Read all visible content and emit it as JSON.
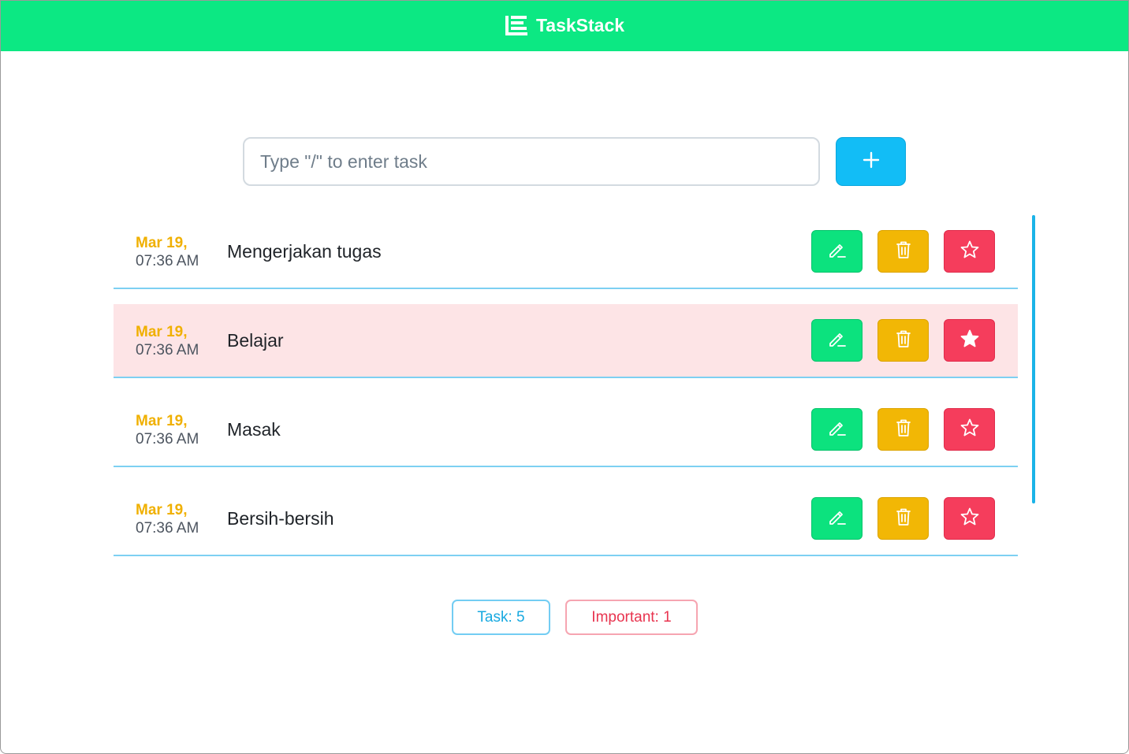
{
  "header": {
    "title": "TaskStack",
    "background_color": "#0ce883",
    "logo_icon": "stacked-list-icon"
  },
  "input": {
    "placeholder": "Type \"/\" to enter task",
    "value": "",
    "add_icon": "plus-icon"
  },
  "tasks": [
    {
      "date": "Mar 19,",
      "time": "07:36 AM",
      "text": "Mengerjakan tugas",
      "important": false
    },
    {
      "date": "Mar 19,",
      "time": "07:36 AM",
      "text": "Belajar",
      "important": true
    },
    {
      "date": "Mar 19,",
      "time": "07:36 AM",
      "text": "Masak",
      "important": false
    },
    {
      "date": "Mar 19,",
      "time": "07:36 AM",
      "text": "Bersih-bersih",
      "important": false
    }
  ],
  "actions": {
    "edit_icon": "pencil-icon",
    "delete_icon": "trash-icon",
    "important_icon": "star-icon",
    "edit_color": "#0ce27e",
    "delete_color": "#f2b705",
    "important_color": "#f53d5c"
  },
  "counters": {
    "task_label": "Task: 5",
    "important_label": "Important: 1"
  }
}
